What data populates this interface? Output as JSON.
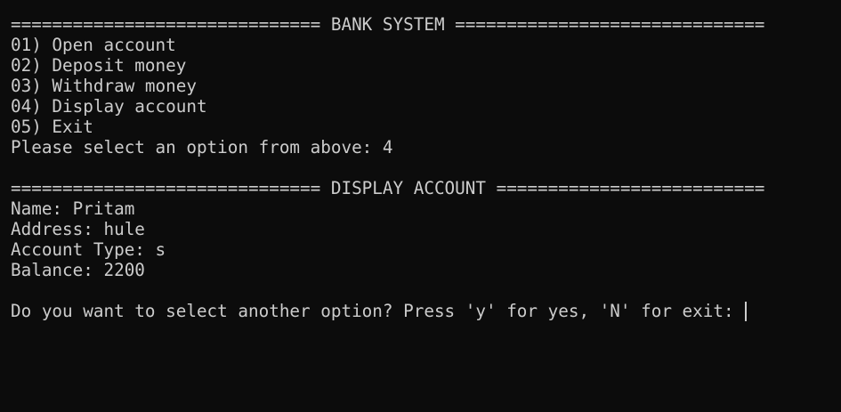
{
  "terminal": {
    "colors": {
      "background": "#0c0c0c",
      "foreground": "#cccccc"
    },
    "menu": {
      "header": "============================== BANK SYSTEM ==============================",
      "options": [
        "01) Open account",
        "02) Deposit money",
        "03) Withdraw money",
        "04) Display account",
        "05) Exit"
      ],
      "prompt": "Please select an option from above: 4"
    },
    "display": {
      "header": "============================== DISPLAY ACCOUNT ==========================",
      "name": "Name: Pritam",
      "address": "Address: hule",
      "account_type": "Account Type: s",
      "balance": "Balance: 2200"
    },
    "continue_prompt": "Do you want to select another option? Press 'y' for yes, 'N' for exit: "
  }
}
